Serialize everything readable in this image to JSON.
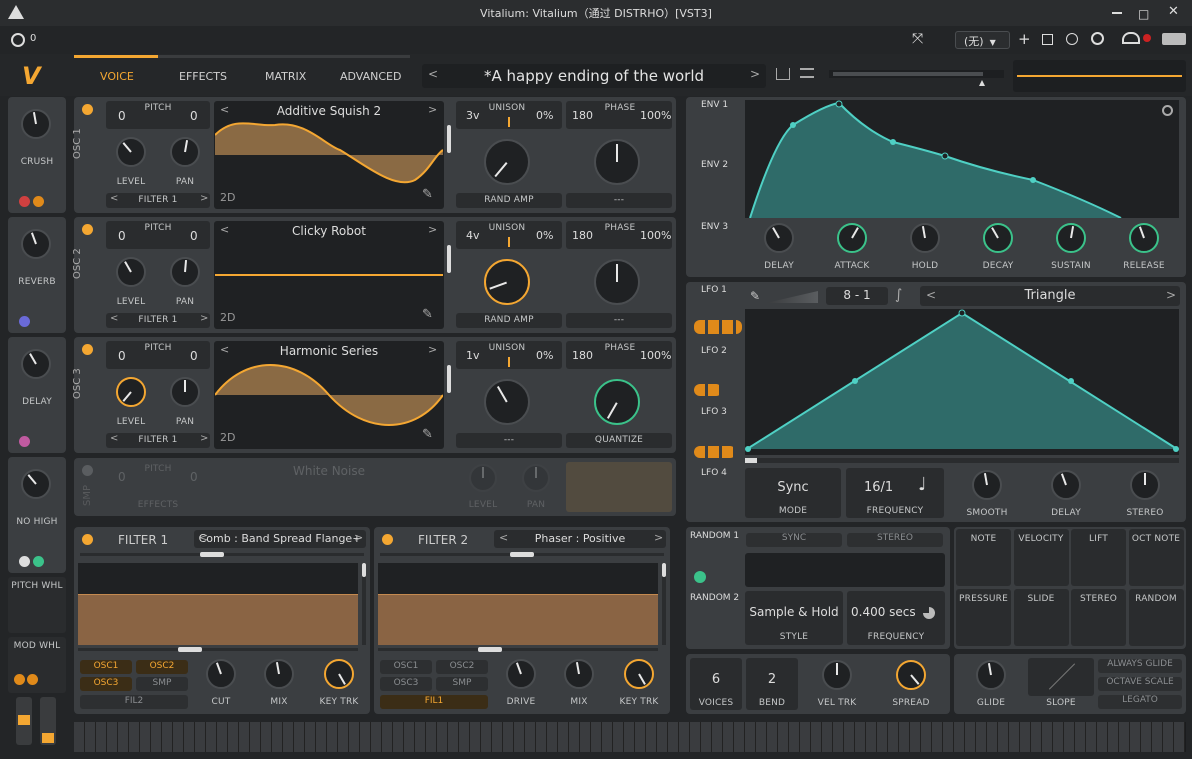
{
  "window": {
    "title": "Vitalium: Vitalium（通过 DISTRHO）[VST3]",
    "host_preset": "(无)"
  },
  "header": {
    "tabs": [
      "VOICE",
      "EFFECTS",
      "MATRIX",
      "ADVANCED"
    ],
    "active_tab": "VOICE",
    "preset_name": "*A happy ending of the world",
    "counter": "0"
  },
  "sidebar": [
    {
      "label": "CRUSH"
    },
    {
      "label": "REVERB"
    },
    {
      "label": "DELAY"
    },
    {
      "label": "NO HIGH"
    },
    {
      "label": "PITCH WHL"
    },
    {
      "label": "MOD WHL"
    }
  ],
  "oscillators": [
    {
      "name": "OSC 1",
      "pitch_label": "PITCH",
      "pitch_left": "0",
      "pitch_right": "0",
      "wavetable": "Additive Squish 2",
      "mode": "2D",
      "level": "LEVEL",
      "pan": "PAN",
      "dest": "FILTER 1",
      "unison_voices": "3v",
      "unison_label": "UNISON",
      "unison_pct": "0%",
      "phase_val": "180",
      "phase_label": "PHASE",
      "phase_pct": "100%",
      "bottom_left": "RAND AMP",
      "bottom_right": "---"
    },
    {
      "name": "OSC 2",
      "pitch_label": "PITCH",
      "pitch_left": "0",
      "pitch_right": "0",
      "wavetable": "Clicky Robot",
      "mode": "2D",
      "level": "LEVEL",
      "pan": "PAN",
      "dest": "FILTER 1",
      "unison_voices": "4v",
      "unison_label": "UNISON",
      "unison_pct": "0%",
      "phase_val": "180",
      "phase_label": "PHASE",
      "phase_pct": "100%",
      "bottom_left": "RAND AMP",
      "bottom_right": "---"
    },
    {
      "name": "OSC 3",
      "pitch_label": "PITCH",
      "pitch_left": "0",
      "pitch_right": "0",
      "wavetable": "Harmonic Series",
      "mode": "2D",
      "level": "LEVEL",
      "pan": "PAN",
      "dest": "FILTER 1",
      "unison_voices": "1v",
      "unison_label": "UNISON",
      "unison_pct": "0%",
      "phase_val": "180",
      "phase_label": "PHASE",
      "phase_pct": "100%",
      "bottom_left": "---",
      "bottom_right": "QUANTIZE"
    }
  ],
  "sampler": {
    "name": "SMP",
    "pitch_label": "PITCH",
    "pitch_left": "0",
    "pitch_right": "0",
    "sample": "White Noise",
    "level": "LEVEL",
    "pan": "PAN",
    "dest": "EFFECTS"
  },
  "filters": [
    {
      "name": "FILTER 1",
      "type": "Comb : Band Spread Flange+",
      "src": [
        "OSC1",
        "OSC2",
        "OSC3",
        "SMP"
      ],
      "chain": "FIL2",
      "knobs": [
        "CUT",
        "MIX",
        "KEY TRK"
      ]
    },
    {
      "name": "FILTER 2",
      "type": "Phaser : Positive",
      "src": [
        "OSC1",
        "OSC2",
        "OSC3",
        "SMP"
      ],
      "chain": "FIL1",
      "knobs": [
        "DRIVE",
        "MIX",
        "KEY TRK"
      ]
    }
  ],
  "envelopes": {
    "tabs": [
      "ENV 1",
      "ENV 2",
      "ENV 3"
    ],
    "knobs": [
      "DELAY",
      "ATTACK",
      "HOLD",
      "DECAY",
      "SUSTAIN",
      "RELEASE"
    ]
  },
  "lfos": {
    "tabs": [
      "LFO 1",
      "LFO 2",
      "LFO 3",
      "LFO 4"
    ],
    "tempo": "8  -  1",
    "shape": "Triangle",
    "mode": "Sync",
    "mode_label": "MODE",
    "freq": "16/1",
    "freq_label": "FREQUENCY",
    "knobs": [
      "SMOOTH",
      "DELAY",
      "STEREO"
    ]
  },
  "random": {
    "tabs": [
      "RANDOM 1",
      "RANDOM 2"
    ],
    "sync": "SYNC",
    "stereo": "STEREO",
    "style": "Sample & Hold",
    "style_label": "STYLE",
    "freq": "0.400 secs",
    "freq_label": "FREQUENCY"
  },
  "mod_sources": [
    "NOTE",
    "VELOCITY",
    "LIFT",
    "OCT NOTE",
    "PRESSURE",
    "SLIDE",
    "STEREO",
    "RANDOM"
  ],
  "voice": {
    "voices": "6",
    "voices_label": "VOICES",
    "bend": "2",
    "bend_label": "BEND",
    "vel": "VEL TRK",
    "spread": "SPREAD"
  },
  "glide": {
    "glide": "GLIDE",
    "slope": "SLOPE",
    "always": "ALWAYS GLIDE",
    "octave": "OCTAVE SCALE",
    "legato": "LEGATO"
  }
}
